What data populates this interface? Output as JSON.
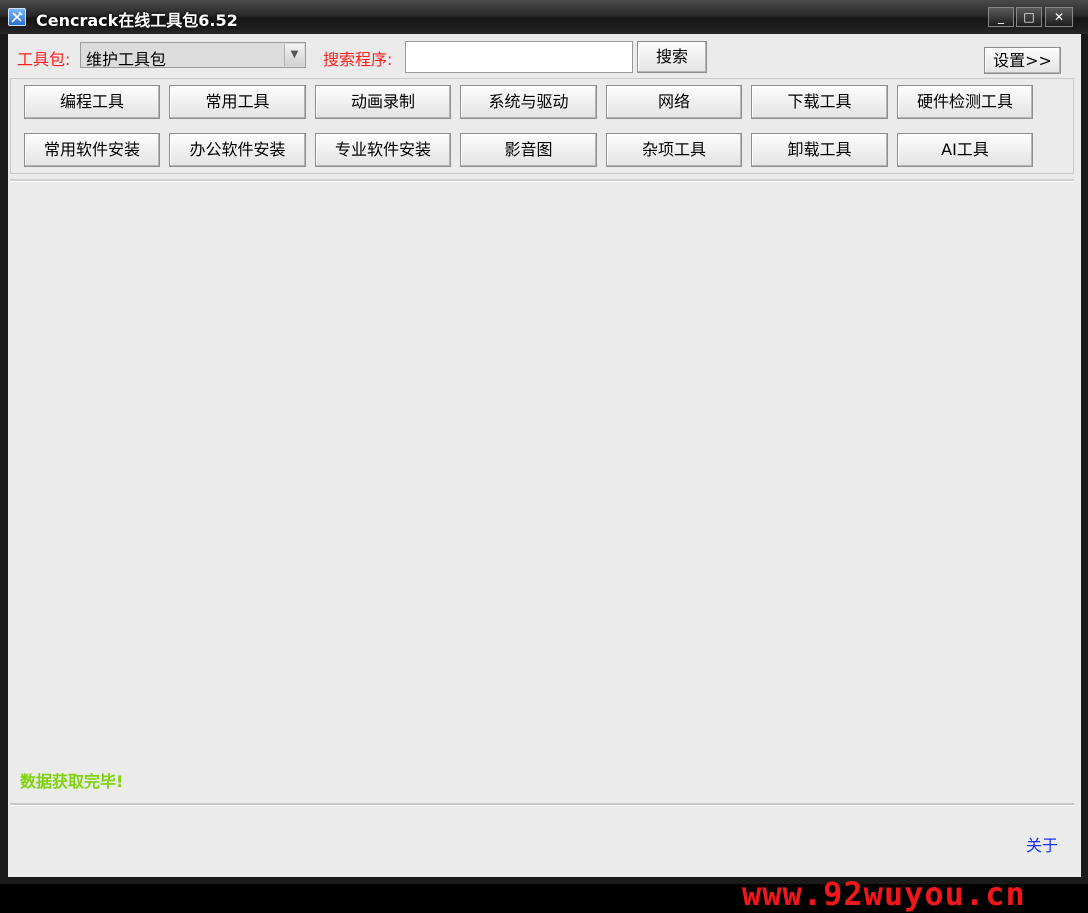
{
  "window": {
    "title": "Cencrack在线工具包6.52",
    "controls": {
      "minimize": "_",
      "maximize": "□",
      "close": "✕"
    }
  },
  "top": {
    "toolkit_label": "工具包:",
    "toolkit_selected": "维护工具包",
    "search_label": "搜索程序:",
    "search_value": "",
    "search_button": "搜索",
    "settings_button": "设置>>"
  },
  "categories": [
    [
      "编程工具",
      "常用工具",
      "动画录制",
      "系统与驱动",
      "网络",
      "下载工具",
      "硬件检测工具"
    ],
    [
      "常用软件安装",
      "办公软件安装",
      "专业软件安装",
      "影音图",
      "杂项工具",
      "卸载工具",
      "AI工具"
    ]
  ],
  "status": "数据获取完毕!",
  "footer": {
    "about_link": "关于"
  },
  "watermark": "www.92wuyou.cn",
  "colors": {
    "label_red": "#ff2020",
    "status_green": "#7fd30c",
    "link_blue": "#1530ff",
    "watermark_red": "#f0171a"
  },
  "icons": {
    "app": "tools-icon"
  }
}
